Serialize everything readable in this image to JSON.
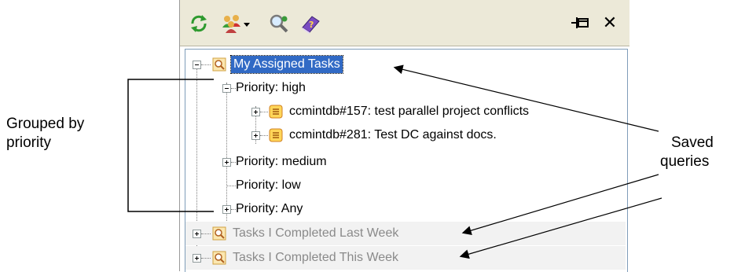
{
  "toolbar": {
    "buttons": [
      {
        "name": "refresh-icon"
      },
      {
        "name": "people-dropdown-icon"
      },
      {
        "name": "query-search-icon"
      },
      {
        "name": "help-book-icon"
      }
    ],
    "pin_glyph": "⊣⊠",
    "close_glyph": "✕"
  },
  "tree": {
    "root": "My Assigned Tasks",
    "groups": [
      {
        "label": "Priority: high",
        "expanded": true
      },
      {
        "label": "Priority: medium",
        "expanded": false
      },
      {
        "label": "Priority: low",
        "expanded": null
      },
      {
        "label": "Priority: Any",
        "expanded": false
      }
    ],
    "tasks": [
      "ccmintdb#157: test parallel project conflicts",
      "ccmintdb#281: Test DC against docs."
    ],
    "other_queries": [
      "Tasks I Completed Last Week",
      "Tasks I Completed This Week"
    ]
  },
  "annotations": {
    "left_line1": "Grouped by",
    "left_line2": "priority",
    "right_line1": "Saved",
    "right_line2": "queries"
  },
  "colors": {
    "selection": "#316ac5",
    "toolbar": "#ece9d8",
    "dim_text": "#8a8a8a"
  }
}
